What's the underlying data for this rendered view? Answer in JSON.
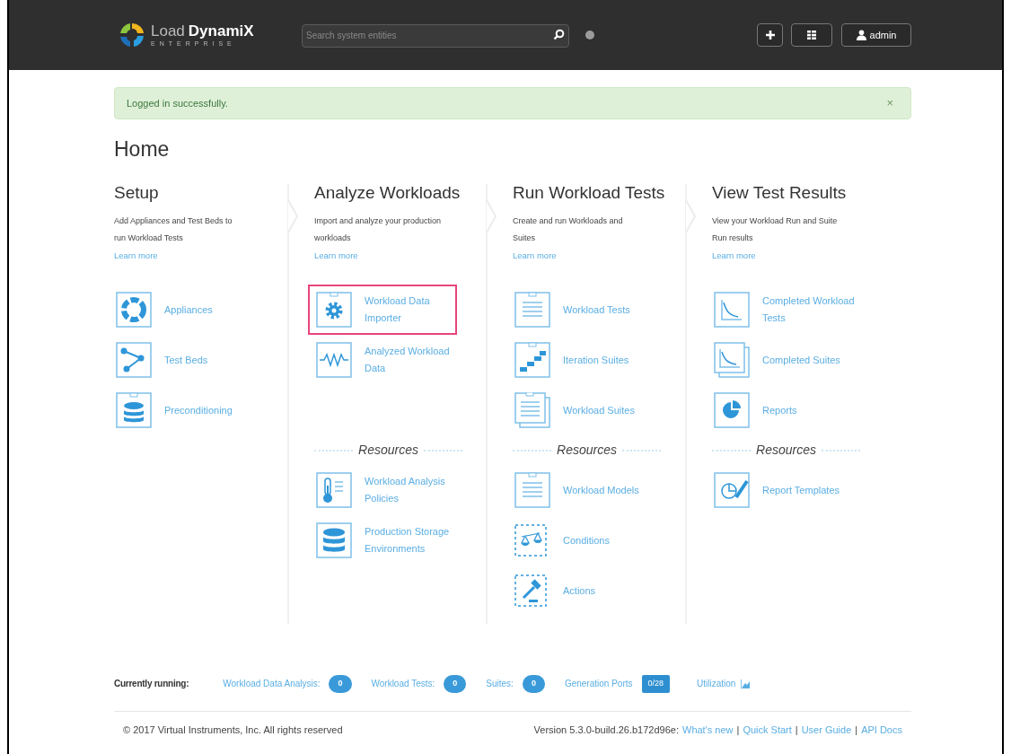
{
  "header": {
    "logo": {
      "word1": "Load",
      "word2": "DynamiX",
      "tagline": "ENTERPRISE"
    },
    "search": {
      "placeholder": "Search system entities"
    },
    "user": "admin"
  },
  "alert": {
    "text": "Logged in successfully.",
    "close": "×"
  },
  "page_title": "Home",
  "columns": [
    {
      "title": "Setup",
      "description": "Add Appliances and Test Beds to run Workload Tests",
      "link": "Learn more",
      "items": [
        {
          "label": "Appliances",
          "highlighted": false
        },
        {
          "label": "Test Beds",
          "highlighted": false
        },
        {
          "label": "Preconditioning",
          "highlighted": false
        }
      ]
    },
    {
      "title": "Analyze Workloads",
      "description": "Import and analyze your production workloads",
      "link": "Learn more",
      "items": [
        {
          "label": "Workload Data Importer",
          "highlighted": true
        },
        {
          "label": "Analyzed Workload Data",
          "highlighted": false
        }
      ],
      "resources": {
        "heading": "Resources",
        "items": [
          {
            "label": "Workload Analysis Policies"
          },
          {
            "label": "Production Storage Environments"
          }
        ]
      }
    },
    {
      "title": "Run Workload Tests",
      "description": "Create and run Workloads and Suites",
      "link": "Learn more",
      "items": [
        {
          "label": "Workload Tests",
          "highlighted": false
        },
        {
          "label": "Iteration Suites",
          "highlighted": false
        },
        {
          "label": "Workload Suites",
          "highlighted": false
        }
      ],
      "resources": {
        "heading": "Resources",
        "items": [
          {
            "label": "Workload Models"
          },
          {
            "label": "Conditions"
          },
          {
            "label": "Actions"
          }
        ]
      }
    },
    {
      "title": "View Test Results",
      "description": "View your Workload Run and Suite Run results",
      "link": "Learn more",
      "items": [
        {
          "label": "Completed Workload Tests",
          "highlighted": false
        },
        {
          "label": "Completed Suites",
          "highlighted": false
        },
        {
          "label": "Reports",
          "highlighted": false
        }
      ],
      "resources": {
        "heading": "Resources",
        "items": [
          {
            "label": "Report Templates"
          }
        ]
      }
    }
  ],
  "status_bar": {
    "label": "Currently running:",
    "stats": [
      {
        "label": "Workload Data Analysis:",
        "count": "0",
        "kind": "pill"
      },
      {
        "label": "Workload Tests:",
        "count": "0",
        "kind": "pill"
      },
      {
        "label": "Suites:",
        "count": "0",
        "kind": "pill"
      },
      {
        "label": "Generation Ports",
        "count": "0/28",
        "kind": "square"
      }
    ],
    "utilization": "Utilization"
  },
  "footer": {
    "copyright": "© 2017 Virtual Instruments, Inc. All rights reserved",
    "items": [
      {
        "kind": "text",
        "text": "Version 5.3.0-build.26.b172d96e:"
      },
      {
        "kind": "link",
        "text": "What's new"
      },
      {
        "kind": "separator",
        "text": "|"
      },
      {
        "kind": "link",
        "text": "Quick Start"
      },
      {
        "kind": "separator",
        "text": "|"
      },
      {
        "kind": "link",
        "text": "User Guide"
      },
      {
        "kind": "separator",
        "text": "|"
      },
      {
        "kind": "link",
        "text": "API Docs"
      }
    ]
  }
}
